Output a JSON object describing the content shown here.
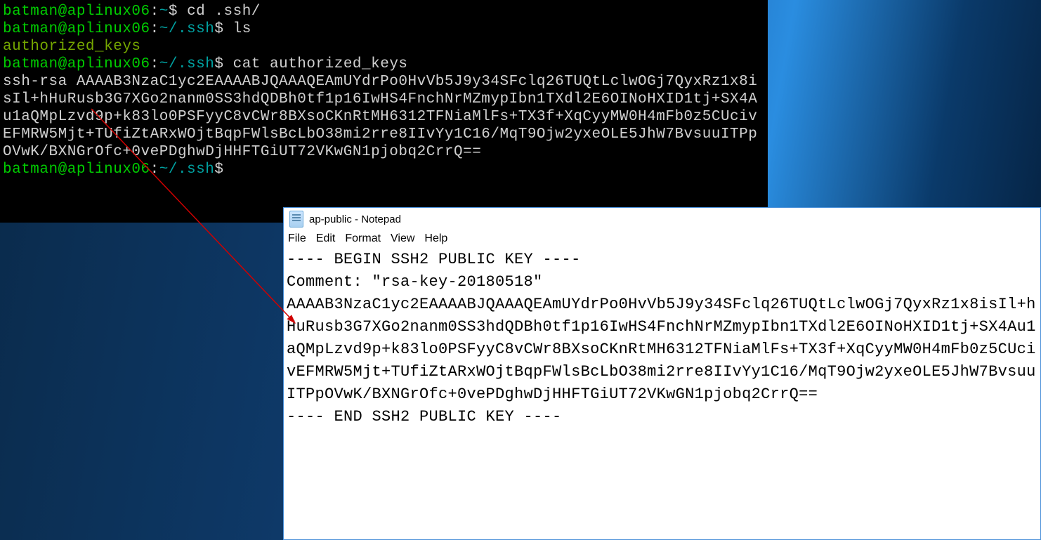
{
  "terminal": {
    "user": "batman",
    "host": "aplinux06",
    "lines": [
      {
        "prompt_user": "batman@aplinux06",
        "prompt_path": "~",
        "cmd": "cd .ssh/"
      },
      {
        "prompt_user": "batman@aplinux06",
        "prompt_path": "~/.ssh",
        "cmd": "ls"
      },
      {
        "output": "authorized_keys",
        "class": "greenish"
      },
      {
        "prompt_user": "batman@aplinux06",
        "prompt_path": "~/.ssh",
        "cmd": "cat authorized_keys"
      },
      {
        "output": "ssh-rsa AAAAB3NzaC1yc2EAAAABJQAAAQEAmUYdrPo0HvVb5J9y34SFclq26TUQtLclwOGj7QyxRz1x8isIl+hHuRusb3G7XGo2nanm0SS3hdQDBh0tf1p16IwHS4FnchNrMZmypIbn1TXdl2E6OINoHXID1tj+SX4Au1aQMpLzvd9p+k83lo0PSFyyC8vCWr8BXsoCKnRtMH6312TFNiaMlFs+TX3f+XqCyyMW0H4mFb0z5CUcivEFMRW5Mjt+TUfiZtARxWOjtBqpFWlsBcLbO38mi2rre8IIvYy1C16/MqT9Ojw2yxeOLE5JhW7BvsuuITPpOVwK/BXNGrOfc+0vePDghwDjHHFTGiUT72VKwGN1pjobq2CrrQ=="
      },
      {
        "prompt_user": "batman@aplinux06",
        "prompt_path": "~/.ssh",
        "cmd": ""
      }
    ]
  },
  "notepad": {
    "title": "ap-public - Notepad",
    "menu": [
      "File",
      "Edit",
      "Format",
      "View",
      "Help"
    ],
    "content": "---- BEGIN SSH2 PUBLIC KEY ----\nComment: \"rsa-key-20180518\"\nAAAAB3NzaC1yc2EAAAABJQAAAQEAmUYdrPo0HvVb5J9y34SFclq26TUQtLclwOGj7QyxRz1x8isIl+hHuRusb3G7XGo2nanm0SS3hdQDBh0tf1p16IwHS4FnchNrMZmypIbn1TXdl2E6OINoHXID1tj+SX4Au1aQMpLzvd9p+k83lo0PSFyyC8vCWr8BXsoCKnRtMH6312TFNiaMlFs+TX3f+XqCyyMW0H4mFb0z5CUcivEFMRW5Mjt+TUfiZtARxWOjtBqpFWlsBcLbO38mi2rre8IIvYy1C16/MqT9Ojw2yxeOLE5JhW7BvsuuITPpOVwK/BXNGrOfc+0vePDghwDjHHFTGiUT72VKwGN1pjobq2CrrQ==\n---- END SSH2 PUBLIC KEY ----"
  }
}
